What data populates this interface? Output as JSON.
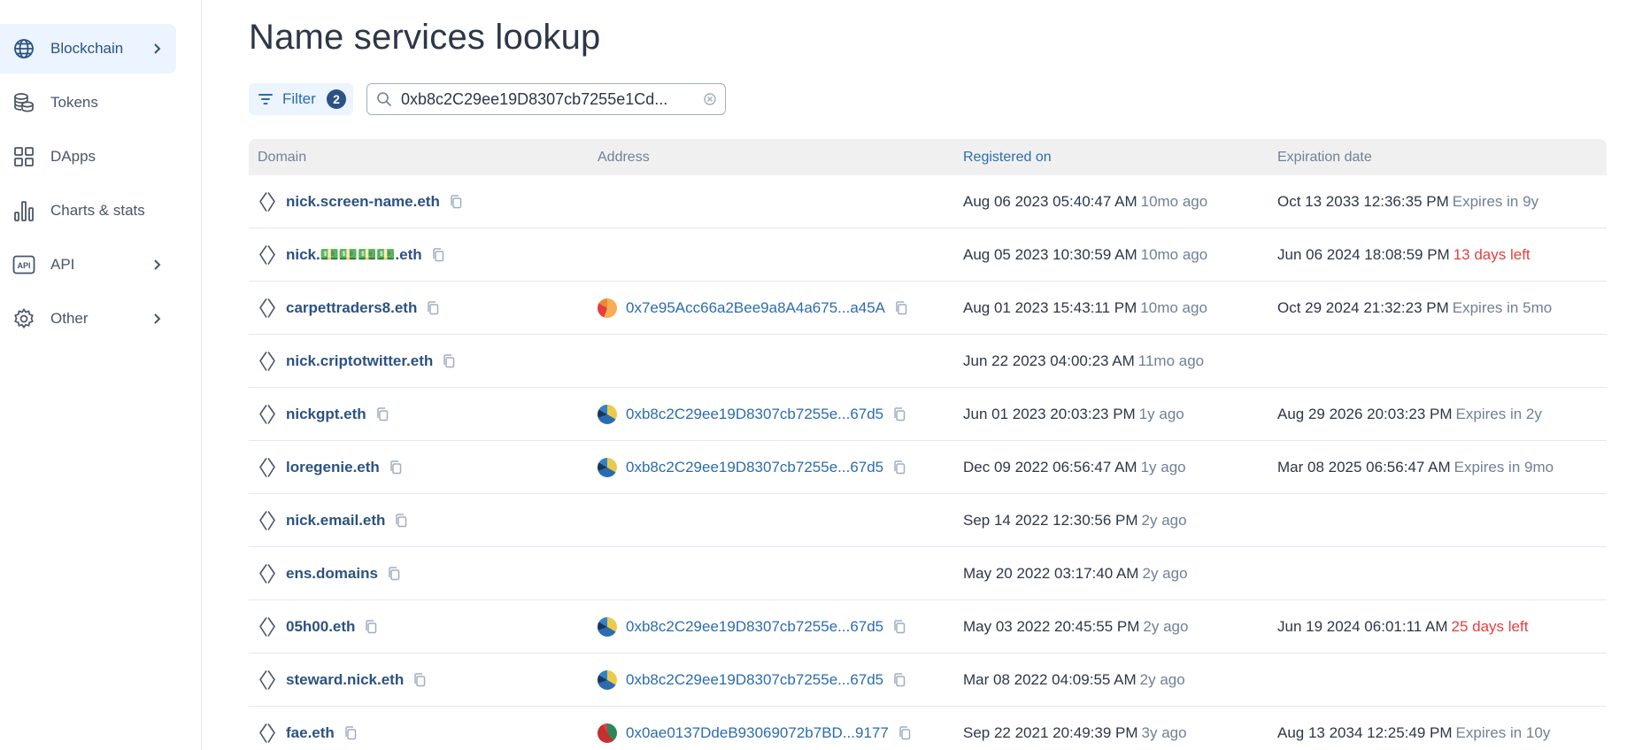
{
  "sidebar": {
    "items": [
      {
        "label": "Blockchain",
        "icon": "globe-icon",
        "active": true,
        "chevron": true
      },
      {
        "label": "Tokens",
        "icon": "coins-icon",
        "active": false,
        "chevron": false
      },
      {
        "label": "DApps",
        "icon": "grid-icon",
        "active": false,
        "chevron": false
      },
      {
        "label": "Charts & stats",
        "icon": "bar-chart-icon",
        "active": false,
        "chevron": false
      },
      {
        "label": "API",
        "icon": "api-icon",
        "active": false,
        "chevron": true
      },
      {
        "label": "Other",
        "icon": "gear-icon",
        "active": false,
        "chevron": true
      }
    ]
  },
  "page": {
    "title": "Name services lookup"
  },
  "toolbar": {
    "filter_label": "Filter",
    "filter_count": "2",
    "search_value": "0xb8c2C29ee19D8307cb7255e1Cd..."
  },
  "table": {
    "headers": {
      "domain": "Domain",
      "address": "Address",
      "registered": "Registered on",
      "expiration": "Expiration date"
    },
    "rows": [
      {
        "domain": "nick.screen-name.eth",
        "address": "",
        "avatar": "",
        "registered": "Aug 06 2023 05:40:47 AM",
        "registered_ago": "10mo ago",
        "expiration": "Oct 13 2033 12:36:35 PM",
        "expires": "Expires in 9y",
        "warn": false
      },
      {
        "domain": "nick.💵💵💵💵.eth",
        "address": "",
        "avatar": "",
        "registered": "Aug 05 2023 10:30:59 AM",
        "registered_ago": "10mo ago",
        "expiration": "Jun 06 2024 18:08:59 PM",
        "expires": "13 days left",
        "warn": true
      },
      {
        "domain": "carpettraders8.eth",
        "address": "0x7e95Acc66a2Bee9a8A4a675...a45A",
        "avatar": "orange",
        "registered": "Aug 01 2023 15:43:11 PM",
        "registered_ago": "10mo ago",
        "expiration": "Oct 29 2024 21:32:23 PM",
        "expires": "Expires in 5mo",
        "warn": false
      },
      {
        "domain": "nick.criptotwitter.eth",
        "address": "",
        "avatar": "",
        "registered": "Jun 22 2023 04:00:23 AM",
        "registered_ago": "11mo ago",
        "expiration": "",
        "expires": "",
        "warn": false
      },
      {
        "domain": "nickgpt.eth",
        "address": "0xb8c2C29ee19D8307cb7255e...67d5",
        "avatar": "blue",
        "registered": "Jun 01 2023 20:03:23 PM",
        "registered_ago": "1y ago",
        "expiration": "Aug 29 2026 20:03:23 PM",
        "expires": "Expires in 2y",
        "warn": false
      },
      {
        "domain": "loregenie.eth",
        "address": "0xb8c2C29ee19D8307cb7255e...67d5",
        "avatar": "blue",
        "registered": "Dec 09 2022 06:56:47 AM",
        "registered_ago": "1y ago",
        "expiration": "Mar 08 2025 06:56:47 AM",
        "expires": "Expires in 9mo",
        "warn": false
      },
      {
        "domain": "nick.email.eth",
        "address": "",
        "avatar": "",
        "registered": "Sep 14 2022 12:30:56 PM",
        "registered_ago": "2y ago",
        "expiration": "",
        "expires": "",
        "warn": false
      },
      {
        "domain": "ens.domains",
        "address": "",
        "avatar": "",
        "registered": "May 20 2022 03:17:40 AM",
        "registered_ago": "2y ago",
        "expiration": "",
        "expires": "",
        "warn": false
      },
      {
        "domain": "05h00.eth",
        "address": "0xb8c2C29ee19D8307cb7255e...67d5",
        "avatar": "blue",
        "registered": "May 03 2022 20:45:55 PM",
        "registered_ago": "2y ago",
        "expiration": "Jun 19 2024 06:01:11 AM",
        "expires": "25 days left",
        "warn": true
      },
      {
        "domain": "steward.nick.eth",
        "address": "0xb8c2C29ee19D8307cb7255e...67d5",
        "avatar": "blue",
        "registered": "Mar 08 2022 04:09:55 AM",
        "registered_ago": "2y ago",
        "expiration": "",
        "expires": "",
        "warn": false
      },
      {
        "domain": "fae.eth",
        "address": "0x0ae0137DdeB93069072b7BD...9177",
        "avatar": "red",
        "registered": "Sep 22 2021 20:49:39 PM",
        "registered_ago": "3y ago",
        "expiration": "Aug 13 2034 12:25:49 PM",
        "expires": "Expires in 10y",
        "warn": false
      }
    ]
  },
  "colors": {
    "accent": "#2b6cb0",
    "link": "#2c5282",
    "active_bg": "#ebf4ff",
    "warn": "#e53e3e",
    "muted": "#718096"
  }
}
